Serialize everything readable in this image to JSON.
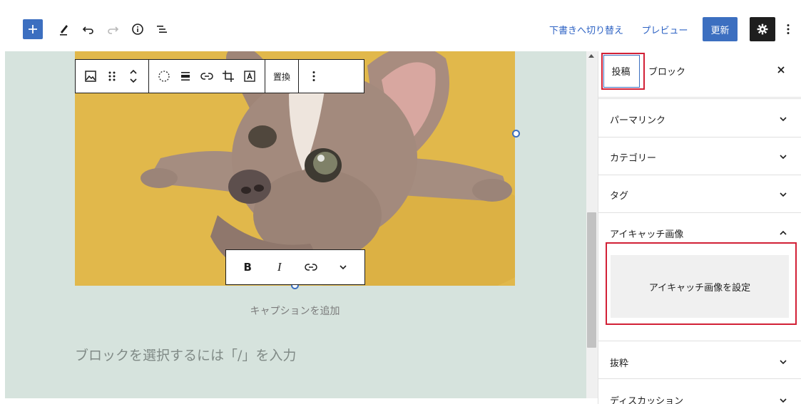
{
  "toolbar": {
    "add_icon": "plus-icon",
    "tools_icon": "pencil-icon",
    "undo_icon": "undo-icon",
    "redo_icon": "redo-icon",
    "details_icon": "info-icon",
    "outline_icon": "list-view-icon",
    "switch_to_draft_label": "下書きへ切り替え",
    "preview_label": "プレビュー",
    "update_label": "更新",
    "settings_icon": "gear-icon",
    "more_icon": "vertical-ellipsis-icon"
  },
  "image_block_toolbar": {
    "replace_label": "置換"
  },
  "caption_toolbar": {
    "bold_label": "B",
    "italic_label": "I"
  },
  "editor": {
    "caption_placeholder": "キャプションを追加",
    "block_placeholder": "ブロックを選択するには「/」を入力"
  },
  "sidebar": {
    "tabs": [
      {
        "label": "投稿",
        "active": true
      },
      {
        "label": "ブロック",
        "active": false
      }
    ],
    "panels": [
      {
        "title": "パーマリンク",
        "expanded": false
      },
      {
        "title": "カテゴリー",
        "expanded": false
      },
      {
        "title": "タグ",
        "expanded": false
      },
      {
        "title": "アイキャッチ画像",
        "expanded": true
      },
      {
        "title": "抜粋",
        "expanded": false
      },
      {
        "title": "ディスカッション",
        "expanded": false
      }
    ],
    "featured_image_button": "アイキャッチ画像を設定"
  },
  "colors": {
    "accent": "#3c6fc0",
    "highlight": "#d22036",
    "canvas": "#d6e3dd"
  }
}
